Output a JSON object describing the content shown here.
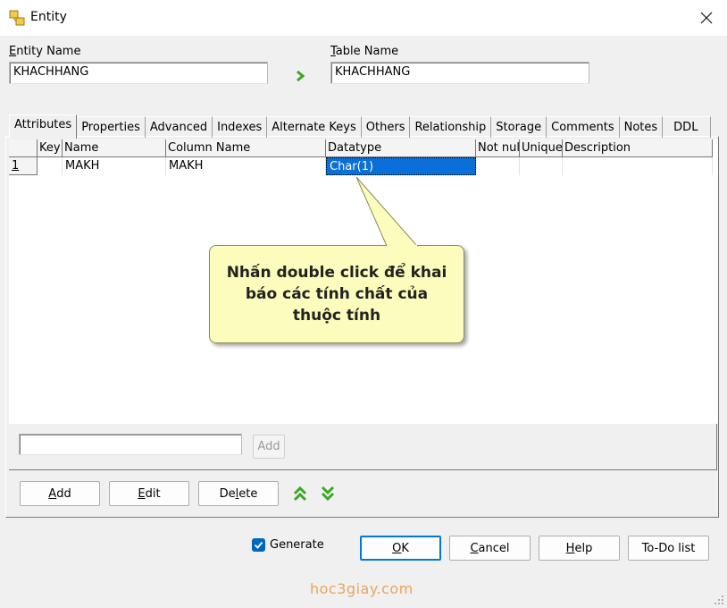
{
  "window": {
    "title": "Entity"
  },
  "fields": {
    "entity_name": {
      "label_first": "E",
      "label_rest": "ntity Name",
      "value": "KHACHHANG"
    },
    "table_name": {
      "label_first": "T",
      "label_rest": "able Name",
      "value": "KHACHHANG"
    }
  },
  "tabs": [
    "Attributes",
    "Properties",
    "Advanced",
    "Indexes",
    "Alternate Keys",
    "Others",
    "Relationship",
    "Storage",
    "Comments",
    "Notes",
    "DDL"
  ],
  "grid": {
    "columns": [
      "Key",
      "Name",
      "Column Name",
      "Datatype",
      "Not nul",
      "Unique",
      "Description"
    ],
    "rows": [
      {
        "num": "1",
        "key": "",
        "name": "MAKH",
        "column_name": "MAKH",
        "datatype": "Char(1)",
        "not_null": "",
        "unique": "",
        "description": ""
      }
    ]
  },
  "tooltip": {
    "text": "Nhấn double click để khai báo các tính chất của thuộc tính"
  },
  "quick_add": {
    "value": "",
    "button": "Add"
  },
  "actions": {
    "add": {
      "first": "A",
      "rest": "dd"
    },
    "edit": {
      "first": "E",
      "rest": "dit"
    },
    "delete": {
      "pre": "De",
      "ul": "l",
      "post": "ete"
    }
  },
  "footer": {
    "generate_label": "Generate",
    "generate_checked": true,
    "ok": {
      "first": "O",
      "rest": "K"
    },
    "cancel": {
      "first": "C",
      "rest": "ancel"
    },
    "help": {
      "first": "H",
      "rest": "elp"
    },
    "todo": "To-Do list"
  },
  "watermark": "hoc3giay.com",
  "colors": {
    "selection": "#0a6fd8",
    "tooltip_bg": "#fcfcbc",
    "accent_green": "#3aa824",
    "checkbox": "#0067c0",
    "watermark": "#e9a65b"
  }
}
